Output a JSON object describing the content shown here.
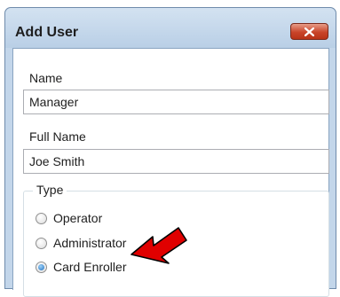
{
  "window": {
    "title": "Add User"
  },
  "form": {
    "name_label": "Name",
    "name_value": "Manager",
    "fullname_label": "Full Name",
    "fullname_value": "Joe Smith",
    "type_label": "Type",
    "types": [
      {
        "label": "Operator",
        "selected": false
      },
      {
        "label": "Administrator",
        "selected": false
      },
      {
        "label": "Card Enroller",
        "selected": true
      }
    ]
  },
  "colors": {
    "title_bar": "#c3d6ea",
    "close_button": "#c9452a",
    "annotation_arrow": "#e00000"
  },
  "icons": {
    "close": "close-icon",
    "annotation": "red-arrow-icon"
  }
}
